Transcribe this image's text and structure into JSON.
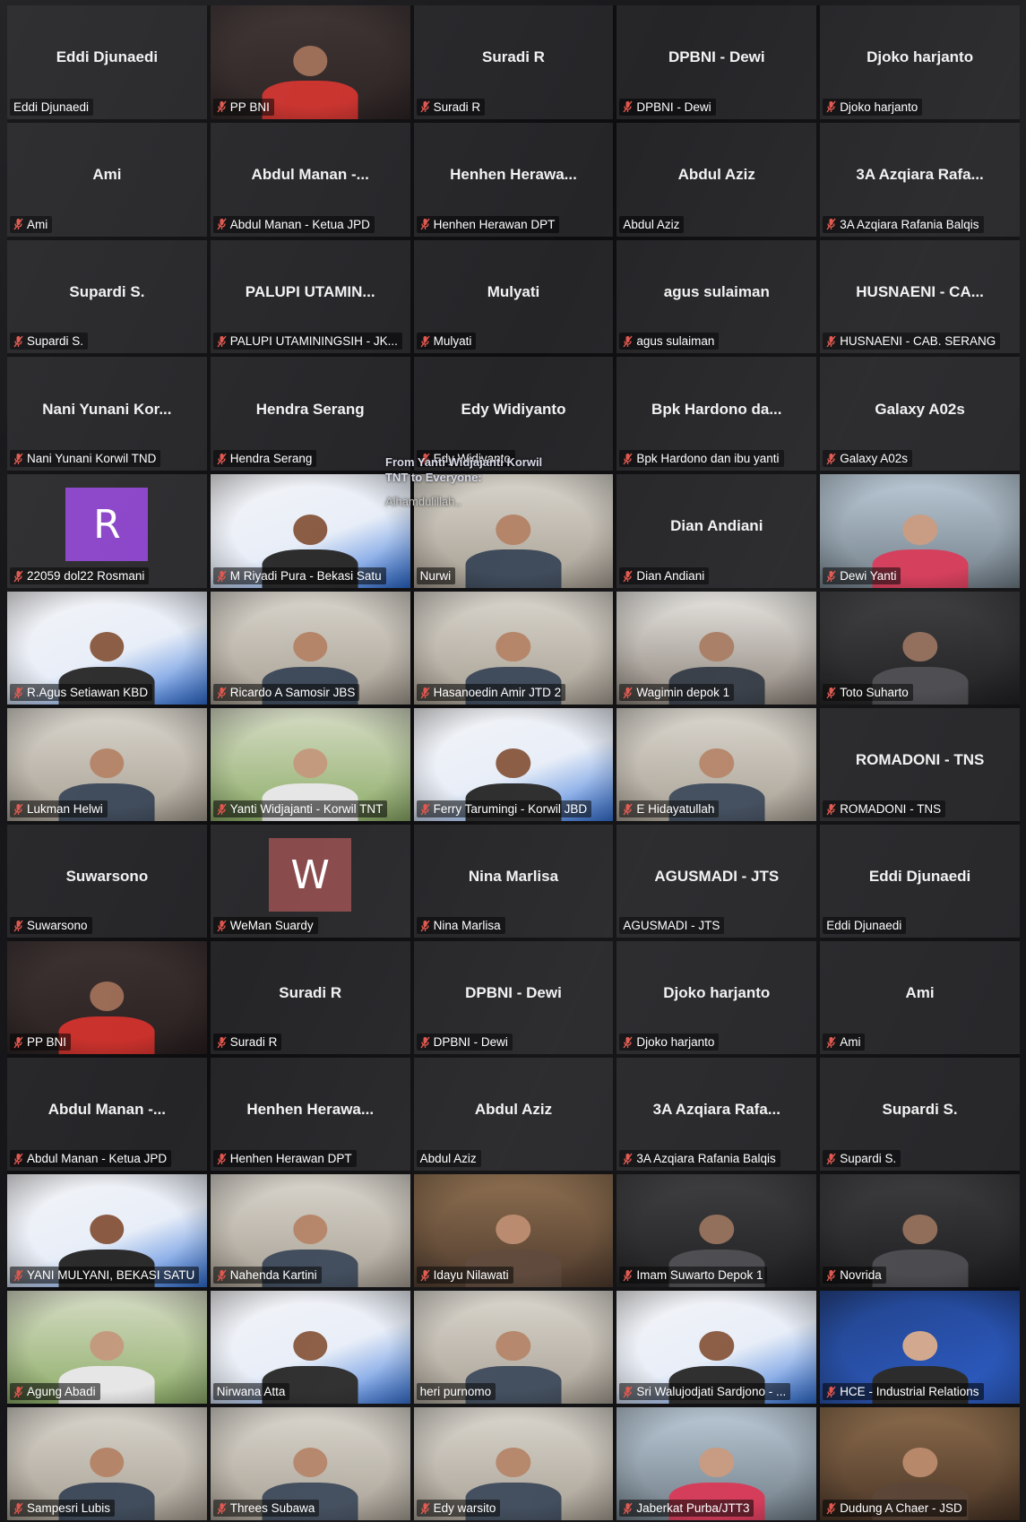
{
  "colors": {
    "tile_bg": "#2a2a2d",
    "mic_muted": "#e0564d",
    "avatar_r": "#8a44c9",
    "avatar_w": "#8a4b4c"
  },
  "chat_overlay": {
    "from_line": "From Yanti Widjajanti Korwil TNT to Everyone:",
    "message": "Alhamdulillah.."
  },
  "gallery_page_1": [
    {
      "title": "Eddi Djunaedi",
      "label": "Eddi Djunaedi",
      "muted": false,
      "kind": "name"
    },
    {
      "title": "",
      "label": "PP BNI",
      "muted": true,
      "kind": "photo",
      "scene": "group"
    },
    {
      "title": "Suradi  R",
      "label": "Suradi  R",
      "muted": true,
      "kind": "name"
    },
    {
      "title": "DPBNI - Dewi",
      "label": "DPBNI - Dewi",
      "muted": true,
      "kind": "name"
    },
    {
      "title": "Djoko harjanto",
      "label": "Djoko harjanto",
      "muted": true,
      "kind": "name"
    },
    {
      "title": "Ami",
      "label": "Ami",
      "muted": true,
      "kind": "name"
    },
    {
      "title": "Abdul Manan -...",
      "label": "Abdul Manan - Ketua JPD",
      "muted": true,
      "kind": "name"
    },
    {
      "title": "Henhen  Herawa...",
      "label": "Henhen Herawan DPT",
      "muted": true,
      "kind": "name"
    },
    {
      "title": "Abdul Aziz",
      "label": "Abdul Aziz",
      "muted": false,
      "kind": "name"
    },
    {
      "title": "3A Azqiara Rafa...",
      "label": "3A Azqiara Rafania Balqis",
      "muted": true,
      "kind": "name"
    },
    {
      "title": "Supardi S.",
      "label": "Supardi S.",
      "muted": true,
      "kind": "name"
    },
    {
      "title": "PALUPI UTAMIN...",
      "label": "PALUPI UTAMININGSIH - JK...",
      "muted": true,
      "kind": "name"
    },
    {
      "title": "Mulyati",
      "label": "Mulyati",
      "muted": true,
      "kind": "name"
    },
    {
      "title": "agus sulaiman",
      "label": "agus sulaiman",
      "muted": true,
      "kind": "name"
    },
    {
      "title": "HUSNAENI - CA...",
      "label": "HUSNAENI - CAB. SERANG",
      "muted": true,
      "kind": "name"
    },
    {
      "title": "Nani Yunani Kor...",
      "label": "Nani Yunani Korwil TND",
      "muted": true,
      "kind": "name"
    },
    {
      "title": "Hendra Serang",
      "label": "Hendra Serang",
      "muted": true,
      "kind": "name"
    },
    {
      "title": "Edy Widiyanto",
      "label": "Edy Widiyanto",
      "muted": true,
      "kind": "name"
    },
    {
      "title": "Bpk Hardono da...",
      "label": "Bpk Hardono dan ibu yanti",
      "muted": true,
      "kind": "name"
    },
    {
      "title": "Galaxy A02s",
      "label": "Galaxy A02s",
      "muted": true,
      "kind": "name"
    },
    {
      "title": "",
      "label": "22059 dol22 Rosmani",
      "muted": true,
      "kind": "avatar",
      "avatar_letter": "R"
    },
    {
      "title": "",
      "label": "M Riyadi Pura - Bekasi Satu",
      "muted": true,
      "kind": "photo",
      "scene": "poster"
    },
    {
      "title": "",
      "label": "Nurwi",
      "muted": false,
      "kind": "photo",
      "scene": "room"
    },
    {
      "title": "Dian Andiani",
      "label": "Dian Andiani",
      "muted": true,
      "kind": "name"
    },
    {
      "title": "",
      "label": "Dewi Yanti",
      "muted": true,
      "kind": "photo",
      "scene": "outdoor"
    }
  ],
  "gallery_page_2": [
    {
      "title": "",
      "label": "R.Agus Setiawan KBD",
      "muted": true,
      "kind": "photo",
      "scene": "poster"
    },
    {
      "title": "",
      "label": "Ricardo A Samosir JBS",
      "muted": true,
      "kind": "photo",
      "scene": "room"
    },
    {
      "title": "",
      "label": "Hasanoedin Amir JTD 2",
      "muted": true,
      "kind": "photo",
      "scene": "room"
    },
    {
      "title": "",
      "label": "Wagimin depok 1",
      "muted": true,
      "kind": "photo",
      "scene": "window"
    },
    {
      "title": "",
      "label": "Toto Suharto",
      "muted": true,
      "kind": "photo",
      "scene": "dark"
    },
    {
      "title": "",
      "label": "Lukman Helwi",
      "muted": true,
      "kind": "photo",
      "scene": "room"
    },
    {
      "title": "",
      "label": "Yanti Widjajanti - Korwil TNT",
      "muted": true,
      "kind": "photo",
      "scene": "garden"
    },
    {
      "title": "",
      "label": "Ferry Tarumingi - Korwil JBD",
      "muted": true,
      "kind": "photo",
      "scene": "poster"
    },
    {
      "title": "",
      "label": "E Hidayatullah",
      "muted": true,
      "kind": "photo",
      "scene": "room"
    },
    {
      "title": "ROMADONI - TNS",
      "label": "ROMADONI - TNS",
      "muted": true,
      "kind": "name"
    },
    {
      "title": "Suwarsono",
      "label": "Suwarsono",
      "muted": true,
      "kind": "name"
    },
    {
      "title": "",
      "label": "WeMan Suardy",
      "muted": true,
      "kind": "avatar",
      "avatar_letter": "W"
    },
    {
      "title": "Nina Marlisa",
      "label": "Nina Marlisa",
      "muted": true,
      "kind": "name"
    },
    {
      "title": "AGUSMADI - JTS",
      "label": "AGUSMADI - JTS",
      "muted": false,
      "kind": "name"
    },
    {
      "title": "Eddi Djunaedi",
      "label": "Eddi Djunaedi",
      "muted": false,
      "kind": "name"
    },
    {
      "title": "",
      "label": "PP BNI",
      "muted": true,
      "kind": "photo",
      "scene": "group"
    },
    {
      "title": "Suradi  R",
      "label": "Suradi  R",
      "muted": true,
      "kind": "name"
    },
    {
      "title": "DPBNI - Dewi",
      "label": "DPBNI - Dewi",
      "muted": true,
      "kind": "name"
    },
    {
      "title": "Djoko harjanto",
      "label": "Djoko harjanto",
      "muted": true,
      "kind": "name"
    },
    {
      "title": "Ami",
      "label": "Ami",
      "muted": true,
      "kind": "name"
    },
    {
      "title": "Abdul Manan -...",
      "label": "Abdul Manan - Ketua JPD",
      "muted": true,
      "kind": "name"
    },
    {
      "title": "Henhen  Herawa...",
      "label": "Henhen Herawan DPT",
      "muted": true,
      "kind": "name"
    },
    {
      "title": "Abdul Aziz",
      "label": "Abdul Aziz",
      "muted": false,
      "kind": "name"
    },
    {
      "title": "3A Azqiara Rafa...",
      "label": "3A Azqiara Rafania Balqis",
      "muted": true,
      "kind": "name"
    },
    {
      "title": "Supardi S.",
      "label": "Supardi S.",
      "muted": true,
      "kind": "name"
    },
    {
      "title": "",
      "label": "YANI MULYANI, BEKASI SATU",
      "muted": true,
      "kind": "photo",
      "scene": "poster"
    },
    {
      "title": "",
      "label": "Nahenda Kartini",
      "muted": true,
      "kind": "photo",
      "scene": "room"
    },
    {
      "title": "",
      "label": "Idayu Nilawati",
      "muted": true,
      "kind": "photo",
      "scene": "warm"
    },
    {
      "title": "",
      "label": "Imam Suwarto Depok 1",
      "muted": true,
      "kind": "photo",
      "scene": "dark"
    },
    {
      "title": "",
      "label": "Novrida",
      "muted": true,
      "kind": "photo",
      "scene": "dark"
    },
    {
      "title": "",
      "label": "Agung Abadi",
      "muted": true,
      "kind": "photo",
      "scene": "garden"
    },
    {
      "title": "",
      "label": "Nirwana Atta",
      "muted": false,
      "kind": "photo",
      "scene": "poster"
    },
    {
      "title": "",
      "label": "heri purnomo",
      "muted": false,
      "kind": "photo",
      "scene": "room"
    },
    {
      "title": "",
      "label": "Sri Walujodjati Sardjono - ...",
      "muted": true,
      "kind": "photo",
      "scene": "poster"
    },
    {
      "title": "",
      "label": "HCE - Industrial Relations",
      "muted": true,
      "kind": "photo",
      "scene": "blue"
    },
    {
      "title": "",
      "label": "Sampesri Lubis",
      "muted": true,
      "kind": "photo",
      "scene": "room"
    },
    {
      "title": "",
      "label": "Threes Subawa",
      "muted": true,
      "kind": "photo",
      "scene": "room"
    },
    {
      "title": "",
      "label": "Edy warsito",
      "muted": true,
      "kind": "photo",
      "scene": "room"
    },
    {
      "title": "",
      "label": "Jaberkat Purba/JTT3",
      "muted": true,
      "kind": "photo",
      "scene": "outdoor"
    },
    {
      "title": "",
      "label": "Dudung A Chaer - JSD",
      "muted": true,
      "kind": "photo",
      "scene": "warm"
    }
  ]
}
